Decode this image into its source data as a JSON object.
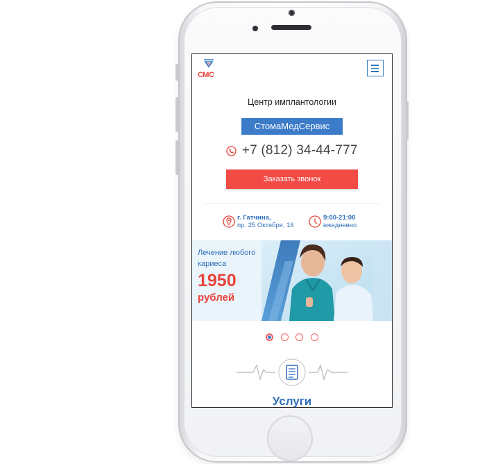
{
  "header": {
    "logo_text": "СМС",
    "logo_icon": "tooth-logo-icon",
    "menu_icon": "hamburger-menu-icon"
  },
  "hero": {
    "subtitle": "Центр имплантологии",
    "brand": "СтомаМедСервис",
    "phone": "+7 (812) 34-44-777",
    "callback_button": "Заказать звонок"
  },
  "info": {
    "address_line1": "г. Гатчина,",
    "address_line2": "пр. 25 Октября, 16",
    "hours_line1": "9:00-21:00",
    "hours_line2": "ежедневно"
  },
  "banner": {
    "caption_line1": "Лечение любого",
    "caption_line2": "кариеса",
    "price": "1950",
    "currency": "рублей"
  },
  "slider": {
    "total": 4,
    "active_index": 0
  },
  "services": {
    "title": "Услуги",
    "icon": "document-icon"
  },
  "colors": {
    "accent_blue": "#3b7bc8",
    "accent_red": "#f24a45",
    "text_blue": "#2f6fba"
  }
}
